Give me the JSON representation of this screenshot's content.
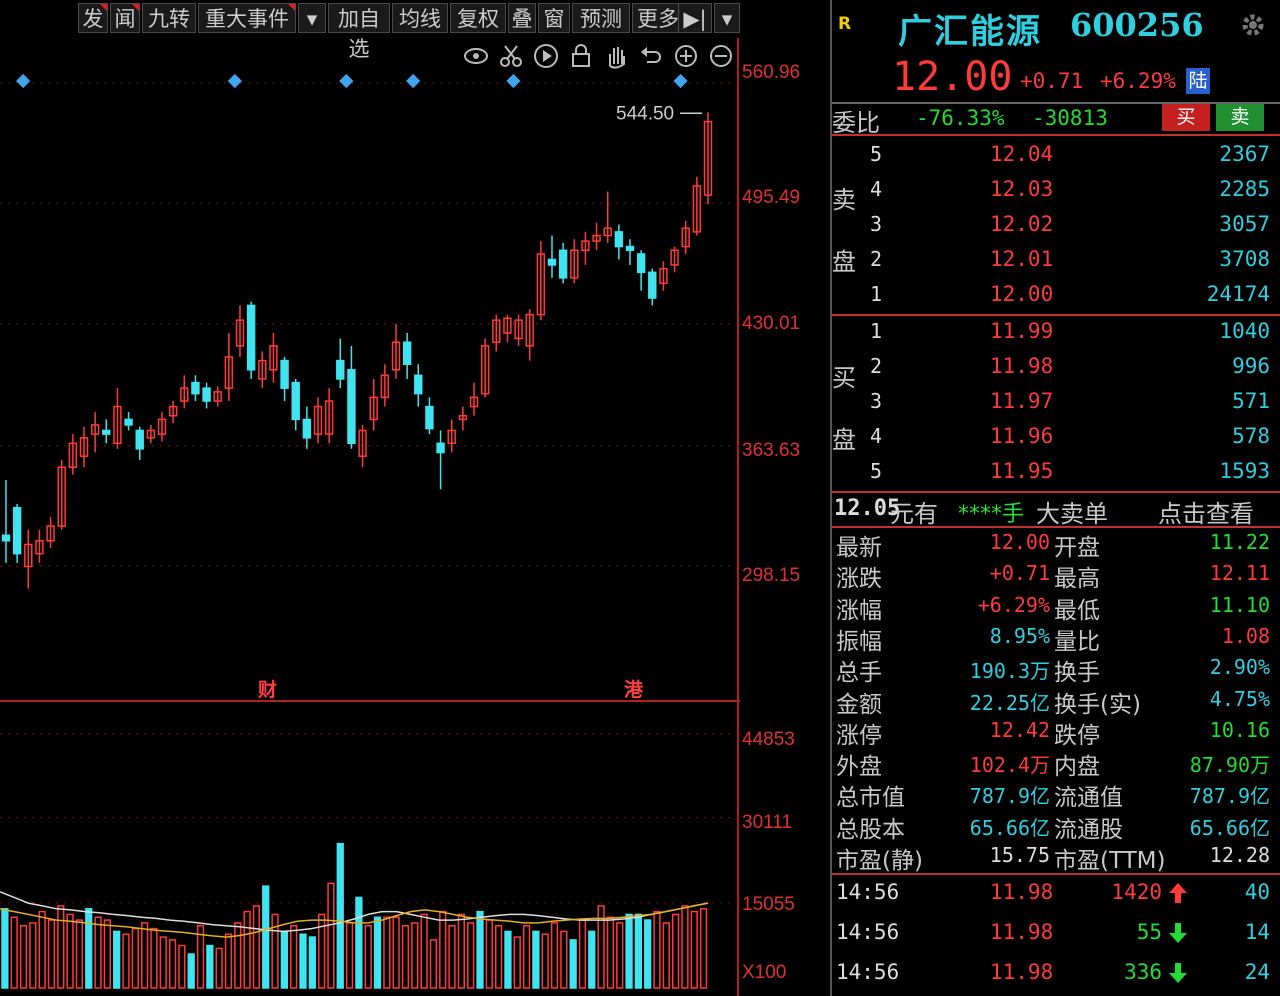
{
  "toolbar": {
    "buttons": [
      "发",
      "闻",
      "九转",
      "重大事件",
      "▾",
      "加自选",
      "均线",
      "复权",
      "叠",
      "窗",
      "预测",
      "更多",
      "▶|",
      "▾"
    ]
  },
  "tools": [
    "eye-icon",
    "scissors-icon",
    "play-icon",
    "lock-icon",
    "hand-icon",
    "undo-icon",
    "zoom-in-icon",
    "zoom-out-icon"
  ],
  "main_chart": {
    "axis_labels": [
      "560.96",
      "495.49",
      "430.01",
      "363.63",
      "298.15"
    ],
    "peak_label": "544.50",
    "markers": [
      "财",
      "港"
    ]
  },
  "volume_chart": {
    "axis_labels": [
      "44853",
      "30111",
      "15055",
      "X100"
    ]
  },
  "chart_data": {
    "type": "candlestick",
    "ylim": [
      270,
      580
    ],
    "peak": 544.5,
    "candles": [
      {
        "o": 315,
        "c": 312,
        "h": 345,
        "l": 300
      },
      {
        "o": 330,
        "c": 305,
        "h": 332,
        "l": 300
      },
      {
        "o": 298,
        "c": 310,
        "h": 318,
        "l": 286
      },
      {
        "o": 305,
        "c": 312,
        "h": 318,
        "l": 300
      },
      {
        "o": 312,
        "c": 320,
        "h": 325,
        "l": 308
      },
      {
        "o": 320,
        "c": 352,
        "h": 356,
        "l": 318
      },
      {
        "o": 352,
        "c": 365,
        "h": 370,
        "l": 348
      },
      {
        "o": 358,
        "c": 368,
        "h": 374,
        "l": 352
      },
      {
        "o": 370,
        "c": 375,
        "h": 382,
        "l": 360
      },
      {
        "o": 372,
        "c": 370,
        "h": 378,
        "l": 365
      },
      {
        "o": 365,
        "c": 385,
        "h": 395,
        "l": 362
      },
      {
        "o": 378,
        "c": 375,
        "h": 382,
        "l": 372
      },
      {
        "o": 372,
        "c": 362,
        "h": 374,
        "l": 356
      },
      {
        "o": 368,
        "c": 372,
        "h": 375,
        "l": 365
      },
      {
        "o": 370,
        "c": 378,
        "h": 382,
        "l": 366
      },
      {
        "o": 380,
        "c": 385,
        "h": 388,
        "l": 376
      },
      {
        "o": 388,
        "c": 395,
        "h": 402,
        "l": 384
      },
      {
        "o": 398,
        "c": 392,
        "h": 402,
        "l": 388
      },
      {
        "o": 395,
        "c": 388,
        "h": 398,
        "l": 384
      },
      {
        "o": 388,
        "c": 393,
        "h": 396,
        "l": 385
      },
      {
        "o": 395,
        "c": 412,
        "h": 425,
        "l": 388
      },
      {
        "o": 418,
        "c": 432,
        "h": 440,
        "l": 412
      },
      {
        "o": 440,
        "c": 405,
        "h": 442,
        "l": 400
      },
      {
        "o": 400,
        "c": 410,
        "h": 415,
        "l": 395
      },
      {
        "o": 405,
        "c": 418,
        "h": 425,
        "l": 398
      },
      {
        "o": 410,
        "c": 395,
        "h": 412,
        "l": 388
      },
      {
        "o": 398,
        "c": 378,
        "h": 400,
        "l": 372
      },
      {
        "o": 378,
        "c": 368,
        "h": 385,
        "l": 362
      },
      {
        "o": 370,
        "c": 385,
        "h": 390,
        "l": 365
      },
      {
        "o": 370,
        "c": 388,
        "h": 395,
        "l": 365
      },
      {
        "o": 410,
        "c": 400,
        "h": 422,
        "l": 395
      },
      {
        "o": 405,
        "c": 365,
        "h": 418,
        "l": 362
      },
      {
        "o": 358,
        "c": 372,
        "h": 375,
        "l": 352
      },
      {
        "o": 378,
        "c": 390,
        "h": 400,
        "l": 372
      },
      {
        "o": 390,
        "c": 402,
        "h": 408,
        "l": 385
      },
      {
        "o": 405,
        "c": 420,
        "h": 430,
        "l": 400
      },
      {
        "o": 420,
        "c": 408,
        "h": 425,
        "l": 400
      },
      {
        "o": 402,
        "c": 392,
        "h": 408,
        "l": 385
      },
      {
        "o": 385,
        "c": 373,
        "h": 390,
        "l": 370
      },
      {
        "o": 365,
        "c": 360,
        "h": 372,
        "l": 340
      },
      {
        "o": 365,
        "c": 372,
        "h": 378,
        "l": 360
      },
      {
        "o": 378,
        "c": 380,
        "h": 385,
        "l": 372
      },
      {
        "o": 385,
        "c": 390,
        "h": 398,
        "l": 380
      },
      {
        "o": 392,
        "c": 418,
        "h": 422,
        "l": 390
      },
      {
        "o": 420,
        "c": 432,
        "h": 435,
        "l": 415
      },
      {
        "o": 425,
        "c": 433,
        "h": 435,
        "l": 420
      },
      {
        "o": 422,
        "c": 432,
        "h": 435,
        "l": 418
      },
      {
        "o": 418,
        "c": 435,
        "h": 438,
        "l": 410
      },
      {
        "o": 435,
        "c": 468,
        "h": 475,
        "l": 432
      },
      {
        "o": 465,
        "c": 462,
        "h": 478,
        "l": 455
      },
      {
        "o": 470,
        "c": 455,
        "h": 474,
        "l": 452
      },
      {
        "o": 455,
        "c": 470,
        "h": 476,
        "l": 452
      },
      {
        "o": 470,
        "c": 475,
        "h": 480,
        "l": 462
      },
      {
        "o": 475,
        "c": 478,
        "h": 485,
        "l": 470
      },
      {
        "o": 478,
        "c": 482,
        "h": 502,
        "l": 474
      },
      {
        "o": 480,
        "c": 472,
        "h": 484,
        "l": 465
      },
      {
        "o": 472,
        "c": 470,
        "h": 476,
        "l": 462
      },
      {
        "o": 468,
        "c": 458,
        "h": 470,
        "l": 448
      },
      {
        "o": 458,
        "c": 444,
        "h": 460,
        "l": 440
      },
      {
        "o": 452,
        "c": 460,
        "h": 464,
        "l": 448
      },
      {
        "o": 462,
        "c": 470,
        "h": 472,
        "l": 458
      },
      {
        "o": 472,
        "c": 482,
        "h": 486,
        "l": 468
      },
      {
        "o": 480,
        "c": 505,
        "h": 510,
        "l": 478
      },
      {
        "o": 500,
        "c": 540,
        "h": 545,
        "l": 495
      }
    ],
    "volumes": [
      {
        "v": 14000,
        "up": false
      },
      {
        "v": 12500,
        "up": true
      },
      {
        "v": 11000,
        "up": true
      },
      {
        "v": 11500,
        "up": true
      },
      {
        "v": 13500,
        "up": true
      },
      {
        "v": 12000,
        "up": true
      },
      {
        "v": 14500,
        "up": true
      },
      {
        "v": 13000,
        "up": true
      },
      {
        "v": 12000,
        "up": true
      },
      {
        "v": 14000,
        "up": false
      },
      {
        "v": 12500,
        "up": true
      },
      {
        "v": 12000,
        "up": true
      },
      {
        "v": 10000,
        "up": false
      },
      {
        "v": 9500,
        "up": true
      },
      {
        "v": 10500,
        "up": true
      },
      {
        "v": 11500,
        "up": true
      },
      {
        "v": 10500,
        "up": true
      },
      {
        "v": 9000,
        "up": true
      },
      {
        "v": 8500,
        "up": true
      },
      {
        "v": 7500,
        "up": true
      },
      {
        "v": 6000,
        "up": false
      },
      {
        "v": 11000,
        "up": true
      },
      {
        "v": 7500,
        "up": false
      },
      {
        "v": 7000,
        "up": true
      },
      {
        "v": 9500,
        "up": true
      },
      {
        "v": 11500,
        "up": true
      },
      {
        "v": 13500,
        "up": true
      },
      {
        "v": 14500,
        "up": true
      },
      {
        "v": 18000,
        "up": false
      },
      {
        "v": 13000,
        "up": true
      },
      {
        "v": 10000,
        "up": false
      },
      {
        "v": 11000,
        "up": true
      },
      {
        "v": 9500,
        "up": false
      },
      {
        "v": 9000,
        "up": false
      },
      {
        "v": 13000,
        "up": true
      },
      {
        "v": 18500,
        "up": true
      },
      {
        "v": 25500,
        "up": false
      },
      {
        "v": 11500,
        "up": true
      },
      {
        "v": 16000,
        "up": false
      },
      {
        "v": 11000,
        "up": true
      },
      {
        "v": 12500,
        "up": false
      },
      {
        "v": 12500,
        "up": true
      },
      {
        "v": 12500,
        "up": true
      },
      {
        "v": 11000,
        "up": true
      },
      {
        "v": 11500,
        "up": true
      },
      {
        "v": 13000,
        "up": true
      },
      {
        "v": 8500,
        "up": true
      },
      {
        "v": 13500,
        "up": true
      },
      {
        "v": 11000,
        "up": true
      },
      {
        "v": 13000,
        "up": true
      },
      {
        "v": 11500,
        "up": true
      },
      {
        "v": 13500,
        "up": false
      },
      {
        "v": 12000,
        "up": true
      },
      {
        "v": 11000,
        "up": true
      },
      {
        "v": 10000,
        "up": false
      },
      {
        "v": 9000,
        "up": true
      },
      {
        "v": 11000,
        "up": true
      },
      {
        "v": 10000,
        "up": false
      },
      {
        "v": 9500,
        "up": true
      },
      {
        "v": 11500,
        "up": true
      },
      {
        "v": 10000,
        "up": true
      },
      {
        "v": 8500,
        "up": false
      },
      {
        "v": 12000,
        "up": true
      },
      {
        "v": 10000,
        "up": false
      },
      {
        "v": 14500,
        "up": true
      },
      {
        "v": 12500,
        "up": true
      },
      {
        "v": 11500,
        "up": true
      },
      {
        "v": 13000,
        "up": false
      },
      {
        "v": 13000,
        "up": false
      },
      {
        "v": 12000,
        "up": false
      },
      {
        "v": 13500,
        "up": true
      },
      {
        "v": 11500,
        "up": true
      },
      {
        "v": 13000,
        "up": true
      },
      {
        "v": 14500,
        "up": true
      },
      {
        "v": 13500,
        "up": true
      },
      {
        "v": 14000,
        "up": true
      }
    ],
    "ma_white": [
      17000,
      16000,
      15000,
      14500,
      14000,
      13800,
      13500,
      13300,
      13000,
      12800,
      12500,
      12300,
      12000,
      11800,
      11500,
      11200,
      11000,
      10800,
      10500,
      10200,
      10000,
      10200,
      10500,
      11000,
      11500,
      12200,
      13000,
      13500,
      13500,
      13000,
      12500,
      12000,
      12000,
      12200,
      12500,
      12800,
      13000,
      13000,
      12800,
      12500,
      12200,
      12000,
      12000,
      12000,
      12200,
      12500,
      13000,
      13500,
      14000,
      14500,
      15000
    ],
    "ma_yellow": [
      14000,
      13500,
      13000,
      12500,
      12000,
      11800,
      11500,
      11200,
      11000,
      10800,
      10500,
      10200,
      10000,
      9800,
      9500,
      9200,
      9000,
      9300,
      9800,
      10500,
      11200,
      11800,
      12000,
      12000,
      11800,
      11500,
      11500,
      12000,
      12800,
      13500,
      13800,
      13500,
      13000,
      12500,
      12200,
      12000,
      11800,
      11500,
      11500,
      11800,
      12000,
      12200,
      12300,
      12300,
      12500,
      12800,
      13000,
      13500,
      14000,
      14500,
      15000
    ]
  },
  "panel": {
    "badge": "R",
    "name": "广汇能源",
    "code": "600256",
    "price": "12.00",
    "change": "+0.71",
    "change_pct": "+6.29%",
    "tag": "陆",
    "weibi": {
      "label": "委比",
      "pct": "-76.33%",
      "diff": "-30813",
      "buy": "买",
      "sell": "卖"
    },
    "sell_label": [
      "卖",
      "盘"
    ],
    "buy_label": [
      "买",
      "盘"
    ],
    "asks": [
      {
        "lvl": "5",
        "price": "12.04",
        "vol": "2367"
      },
      {
        "lvl": "4",
        "price": "12.03",
        "vol": "2285"
      },
      {
        "lvl": "3",
        "price": "12.02",
        "vol": "3057"
      },
      {
        "lvl": "2",
        "price": "12.01",
        "vol": "3708"
      },
      {
        "lvl": "1",
        "price": "12.00",
        "vol": "24174"
      }
    ],
    "bids": [
      {
        "lvl": "1",
        "price": "11.99",
        "vol": "1040"
      },
      {
        "lvl": "2",
        "price": "11.98",
        "vol": "996"
      },
      {
        "lvl": "3",
        "price": "11.97",
        "vol": "571"
      },
      {
        "lvl": "4",
        "price": "11.96",
        "vol": "578"
      },
      {
        "lvl": "5",
        "price": "11.95",
        "vol": "1593"
      }
    ],
    "bigorder": {
      "price": "12.05",
      "unit": "元有",
      "stars": "****手",
      "label": "大卖单",
      "link": "点击查看"
    },
    "stats": [
      {
        "k1": "最新",
        "v1": "12.00",
        "c1": "red",
        "k2": "开盘",
        "v2": "11.22",
        "c2": "green"
      },
      {
        "k1": "涨跌",
        "v1": "+0.71",
        "c1": "red",
        "k2": "最高",
        "v2": "12.11",
        "c2": "red"
      },
      {
        "k1": "涨幅",
        "v1": "+6.29%",
        "c1": "red",
        "k2": "最低",
        "v2": "11.10",
        "c2": "green"
      },
      {
        "k1": "振幅",
        "v1": "8.95%",
        "c1": "cyan",
        "k2": "量比",
        "v2": "1.08",
        "c2": "red"
      },
      {
        "k1": "总手",
        "v1": "190.3万",
        "c1": "cyan",
        "k2": "换手",
        "v2": "2.90%",
        "c2": "cyan"
      },
      {
        "k1": "金额",
        "v1": "22.25亿",
        "c1": "cyan",
        "k2": "换手(实)",
        "v2": "4.75%",
        "c2": "cyan"
      },
      {
        "k1": "涨停",
        "v1": "12.42",
        "c1": "red",
        "k2": "跌停",
        "v2": "10.16",
        "c2": "green"
      },
      {
        "k1": "外盘",
        "v1": "102.4万",
        "c1": "red",
        "k2": "内盘",
        "v2": "87.90万",
        "c2": "green"
      },
      {
        "k1": "总市值",
        "v1": "787.9亿",
        "c1": "cyan",
        "k2": "流通值",
        "v2": "787.9亿",
        "c2": "cyan"
      },
      {
        "k1": "总股本",
        "v1": "65.66亿",
        "c1": "cyan",
        "k2": "流通股",
        "v2": "65.66亿",
        "c2": "cyan"
      },
      {
        "k1": "市盈(静)",
        "v1": "15.75",
        "c1": "white",
        "k2": "市盈(TTM)",
        "v2": "12.28",
        "c2": "white"
      }
    ],
    "ticks": [
      {
        "time": "14:56",
        "price": "11.98",
        "vol": "1420",
        "dir": "up",
        "n": "40"
      },
      {
        "time": "14:56",
        "price": "11.98",
        "vol": "55",
        "dir": "down",
        "n": "14"
      },
      {
        "time": "14:56",
        "price": "11.98",
        "vol": "336",
        "dir": "down",
        "n": "24"
      }
    ]
  }
}
